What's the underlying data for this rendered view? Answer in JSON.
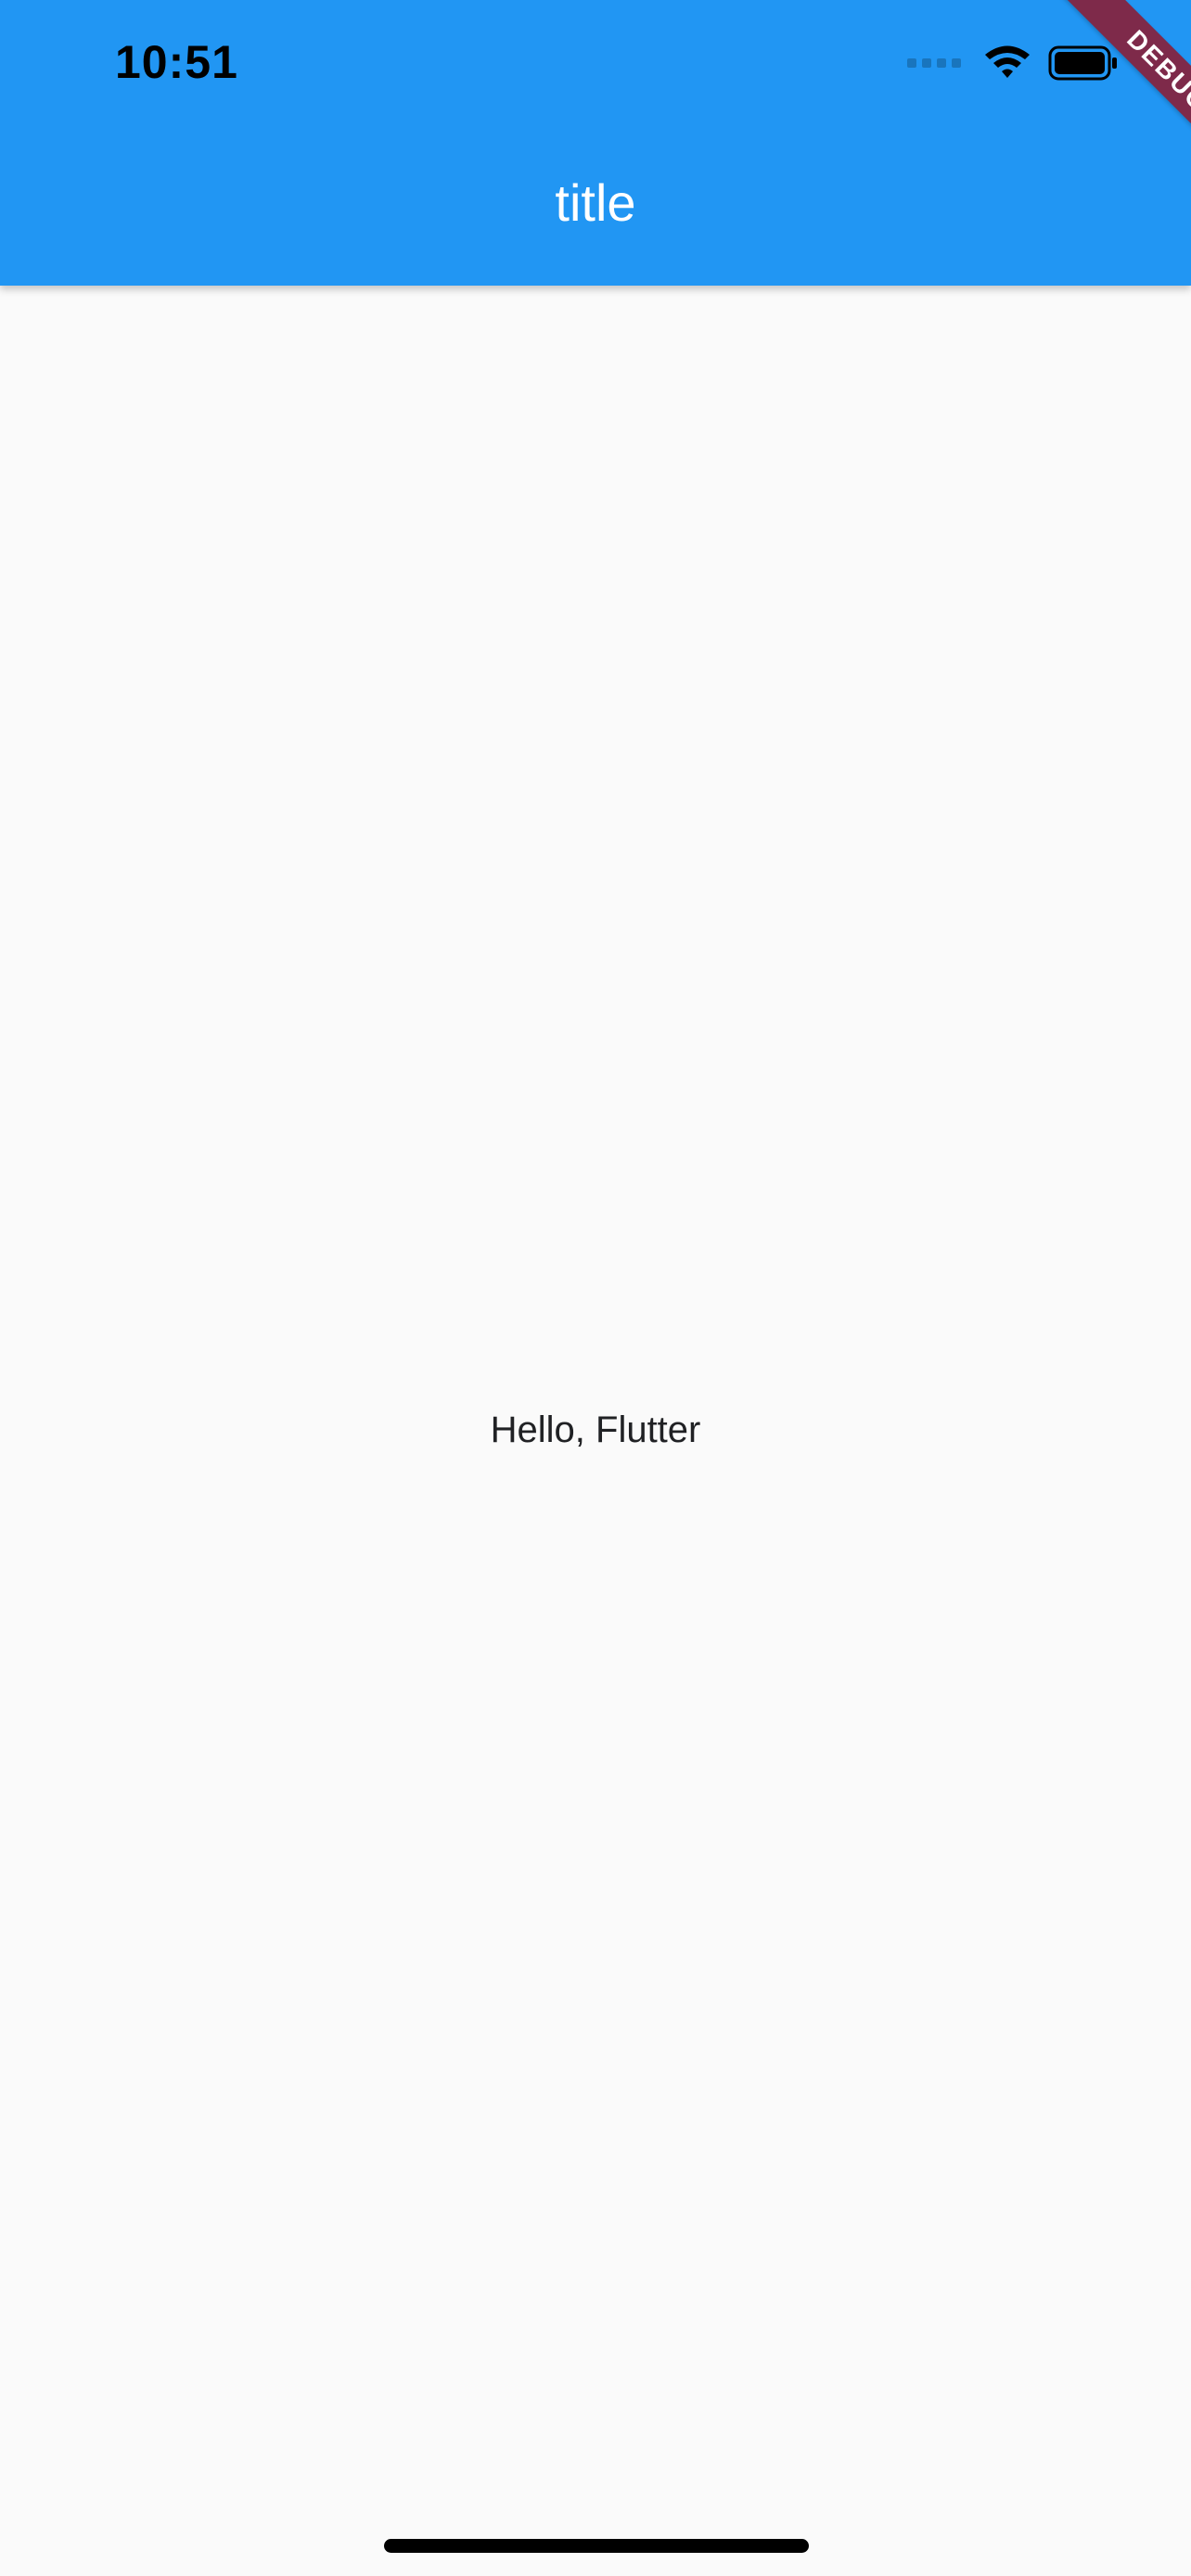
{
  "status_bar": {
    "time": "10:51",
    "icons": [
      "signal-icon",
      "wifi-icon",
      "battery-icon"
    ]
  },
  "app_bar": {
    "title": "title",
    "color": "#2196f3"
  },
  "debug_banner": {
    "label": "DEBUG",
    "color": "#7e2a4a"
  },
  "body": {
    "text": "Hello, Flutter"
  }
}
